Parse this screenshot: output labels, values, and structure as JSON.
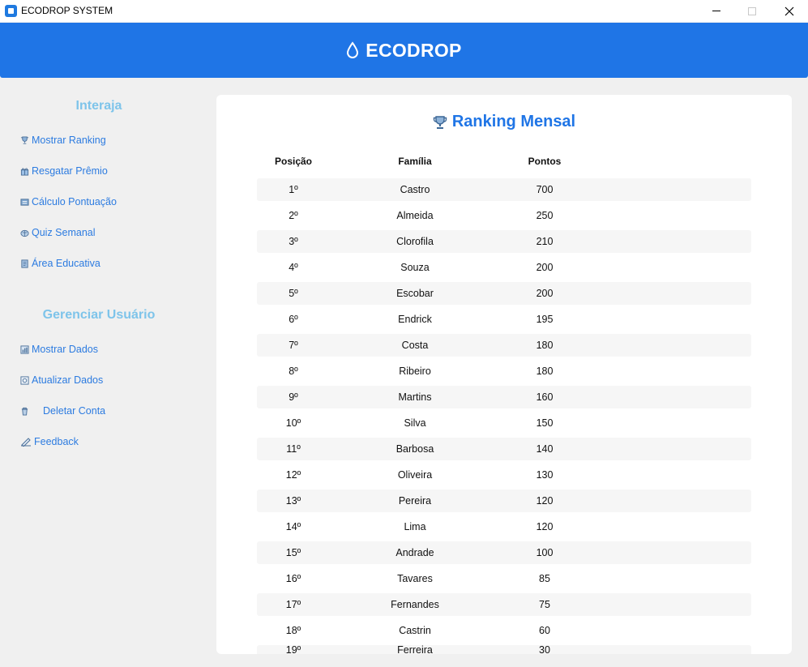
{
  "window": {
    "title": "ECODROP SYSTEM"
  },
  "header": {
    "app_name": "ECODROP",
    "icon": "water-drop-icon"
  },
  "sidebar": {
    "interact_title": "Interaja",
    "interact_items": [
      {
        "label": "Mostrar Ranking",
        "icon": "trophy-icon"
      },
      {
        "label": "Resgatar Prêmio",
        "icon": "gift-icon"
      },
      {
        "label": "Cálculo Pontuação",
        "icon": "calculator-icon"
      },
      {
        "label": "Quiz Semanal",
        "icon": "brain-icon"
      },
      {
        "label": "Área Educativa",
        "icon": "book-icon"
      }
    ],
    "user_title": "Gerenciar Usuário",
    "user_items": [
      {
        "label": "Mostrar Dados",
        "icon": "chart-icon"
      },
      {
        "label": "Atualizar Dados",
        "icon": "refresh-icon"
      },
      {
        "label": "Deletar Conta",
        "icon": "trash-icon"
      },
      {
        "label": "Feedback",
        "icon": "pencil-icon"
      }
    ]
  },
  "ranking": {
    "title": "Ranking Mensal",
    "icon": "trophy-icon",
    "columns": [
      "Posição",
      "Família",
      "Pontos"
    ],
    "rows": [
      {
        "pos": "1º",
        "family": "Castro",
        "points": "700"
      },
      {
        "pos": "2º",
        "family": "Almeida",
        "points": "250"
      },
      {
        "pos": "3º",
        "family": "Clorofila",
        "points": "210"
      },
      {
        "pos": "4º",
        "family": "Souza",
        "points": "200"
      },
      {
        "pos": "5º",
        "family": "Escobar",
        "points": "200"
      },
      {
        "pos": "6º",
        "family": "Endrick",
        "points": "195"
      },
      {
        "pos": "7º",
        "family": "Costa",
        "points": "180"
      },
      {
        "pos": "8º",
        "family": "Ribeiro",
        "points": "180"
      },
      {
        "pos": "9º",
        "family": "Martins",
        "points": "160"
      },
      {
        "pos": "10º",
        "family": "Silva",
        "points": "150"
      },
      {
        "pos": "11º",
        "family": "Barbosa",
        "points": "140"
      },
      {
        "pos": "12º",
        "family": "Oliveira",
        "points": "130"
      },
      {
        "pos": "13º",
        "family": "Pereira",
        "points": "120"
      },
      {
        "pos": "14º",
        "family": "Lima",
        "points": "120"
      },
      {
        "pos": "15º",
        "family": "Andrade",
        "points": "100"
      },
      {
        "pos": "16º",
        "family": "Tavares",
        "points": "85"
      },
      {
        "pos": "17º",
        "family": "Fernandes",
        "points": "75"
      },
      {
        "pos": "18º",
        "family": "Castrin",
        "points": "60"
      },
      {
        "pos": "19º",
        "family": "Ferreira",
        "points": "30"
      }
    ]
  },
  "colors": {
    "primary": "#1f75e6",
    "section_title": "#7ec4ea",
    "link": "#2c7be0"
  }
}
